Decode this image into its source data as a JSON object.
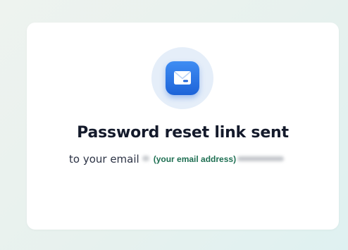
{
  "dialog": {
    "icon": "envelope-icon",
    "title": "Password reset link sent",
    "subtitle_prefix": "to your email",
    "email_placeholder": "(your email address)"
  },
  "colors": {
    "background": "#e7f1ee",
    "card": "#ffffff",
    "icon_circle": "#e5eef9",
    "icon_tile": "#2f7be6",
    "title": "#141a2b",
    "email_text": "#1e6f52"
  }
}
